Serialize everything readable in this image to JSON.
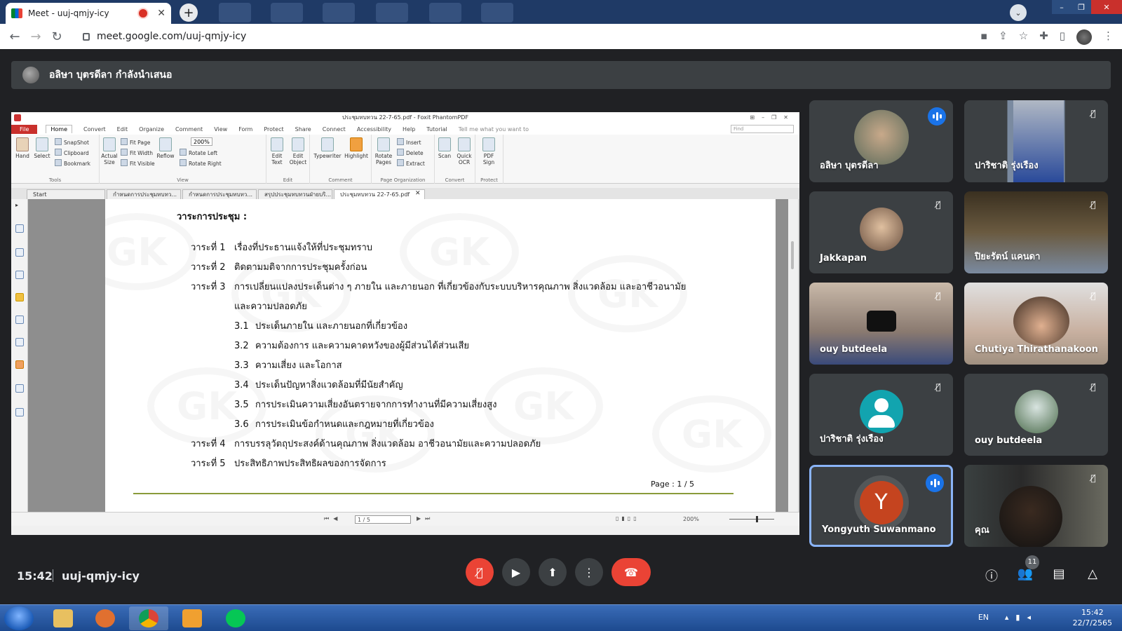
{
  "browser": {
    "tab_title": "Meet - uuj-qmjy-icy",
    "tab_close": "✕",
    "new_tab": "+",
    "url": "meet.google.com/uuj-qmjy-icy"
  },
  "presenter_bar": {
    "text": "อลิษา บุตรดีลา กำลังนำเสนอ"
  },
  "pdf": {
    "window_title": "ประชุมทบทวน 22-7-65.pdf - Foxit PhantomPDF",
    "menus": [
      "File",
      "Home",
      "Convert",
      "Edit",
      "Organize",
      "Comment",
      "View",
      "Form",
      "Protect",
      "Share",
      "Connect",
      "Accessibility",
      "Help",
      "Tutorial"
    ],
    "tell_me": "Tell me what you want to",
    "find_placeholder": "Find",
    "ribbon": {
      "hand": "Hand",
      "select": "Select",
      "snapshot": "SnapShot",
      "clipboard": "Clipboard",
      "bookmark": "Bookmark",
      "tools_cap": "Tools",
      "actual_size": "Actual Size",
      "fit_page": "Fit Page",
      "fit_width": "Fit Width",
      "fit_visible": "Fit Visible",
      "reflow": "Reflow",
      "zoom": "200%",
      "rotate_left": "Rotate Left",
      "rotate_right": "Rotate Right",
      "view_cap": "View",
      "edit_text": "Edit Text",
      "edit_object": "Edit Object",
      "edit_cap": "Edit",
      "typewriter": "Typewriter",
      "highlight": "Highlight",
      "comment_cap": "Comment",
      "rotate_pages": "Rotate Pages",
      "insert": "Insert",
      "delete": "Delete",
      "extract": "Extract",
      "page_org_cap": "Page Organization",
      "scan": "Scan",
      "quick_ocr": "Quick OCR",
      "convert_cap": "Convert",
      "pdf_sign": "PDF Sign",
      "protect_cap": "Protect"
    },
    "doc_tabs": [
      "Start",
      "กำหนดการประชุมทบทว...",
      "กำหนดการประชุมทบทว...",
      "สรุปประชุมทบทวนฝ่ายบริ...",
      "ประชุมทบทวน 22-7-65.pdf"
    ],
    "document": {
      "heading": "วาระการประชุม :",
      "agenda": [
        {
          "num": "วาระที่ 1",
          "text": "เรื่องที่ประธานแจ้งให้ที่ประชุมทราบ"
        },
        {
          "num": "วาระที่ 2",
          "text": "ติดตามมติจากการประชุมครั้งก่อน"
        },
        {
          "num": "วาระที่ 3",
          "text": "การเปลี่ยนแปลงประเด็นต่าง ๆ ภายใน และภายนอก ที่เกี่ยวข้องกับระบบบริหารคุณภาพ สิ่งแวดล้อม และอาชีวอนามัย"
        },
        {
          "num": "",
          "text": "และความปลอดภัย"
        }
      ],
      "subitems": [
        {
          "num": "3.1",
          "text": "ประเด็นภายใน และภายนอกที่เกี่ยวข้อง"
        },
        {
          "num": "3.2",
          "text": "ความต้องการ และความคาดหวังของผู้มีส่วนได้ส่วนเสีย"
        },
        {
          "num": "3.3",
          "text": "ความเสี่ยง และโอกาส"
        },
        {
          "num": "3.4",
          "text": "ประเด็นปัญหาสิ่งแวดล้อมที่มีนัยสำคัญ"
        },
        {
          "num": "3.5",
          "text": "การประเมินความเสี่ยงอันตรายจากการทำงานที่มีความเสี่ยงสูง"
        },
        {
          "num": "3.6",
          "text": "การประเมินข้อกำหนดและกฎหมายที่เกี่ยวข้อง"
        }
      ],
      "agenda_tail": [
        {
          "num": "วาระที่ 4",
          "text": "การบรรลุวัตถุประสงค์ด้านคุณภาพ สิ่งแวดล้อม อาชีวอนามัยและความปลอดภัย"
        },
        {
          "num": "วาระที่ 5",
          "text": "ประสิทธิภาพประสิทธิผลของการจัดการ"
        }
      ],
      "page_label": "Page : 1 / 5",
      "watermark": "GK"
    },
    "status": {
      "page_box": "1 / 5",
      "zoom": "200%"
    }
  },
  "participants": [
    {
      "name": "อลิษา บุตรดีลา",
      "speaking": true,
      "muted": false
    },
    {
      "name": "ปาริชาติ รุ่งเรือง",
      "speaking": false,
      "muted": true
    },
    {
      "name": "Jakkapan",
      "speaking": false,
      "muted": true
    },
    {
      "name": "ปิยะรัตน์ แคนดา",
      "speaking": false,
      "muted": true
    },
    {
      "name": "ouy butdeela",
      "speaking": false,
      "muted": true
    },
    {
      "name": "Chutiya Thirathanakoon",
      "speaking": false,
      "muted": true
    },
    {
      "name": "ปาริชาติ รุ่งเรือง",
      "speaking": false,
      "muted": true
    },
    {
      "name": "ouy butdeela",
      "speaking": false,
      "muted": true
    },
    {
      "name": "Yongyuth Suwanmano",
      "speaking": true,
      "muted": false,
      "initial": "Y"
    },
    {
      "name": "คุณ",
      "speaking": false,
      "muted": true
    }
  ],
  "meeting": {
    "time": "15:42",
    "code": "uuj-qmjy-icy",
    "participant_count": "11"
  },
  "taskbar": {
    "lang": "EN",
    "time": "15:42",
    "date": "22/7/2565"
  },
  "colors": {
    "meet_bg": "#202124",
    "tile_bg": "#3c4043",
    "danger": "#ea4335",
    "speaking": "#1a73e8",
    "active_outline": "#8ab4f8"
  }
}
